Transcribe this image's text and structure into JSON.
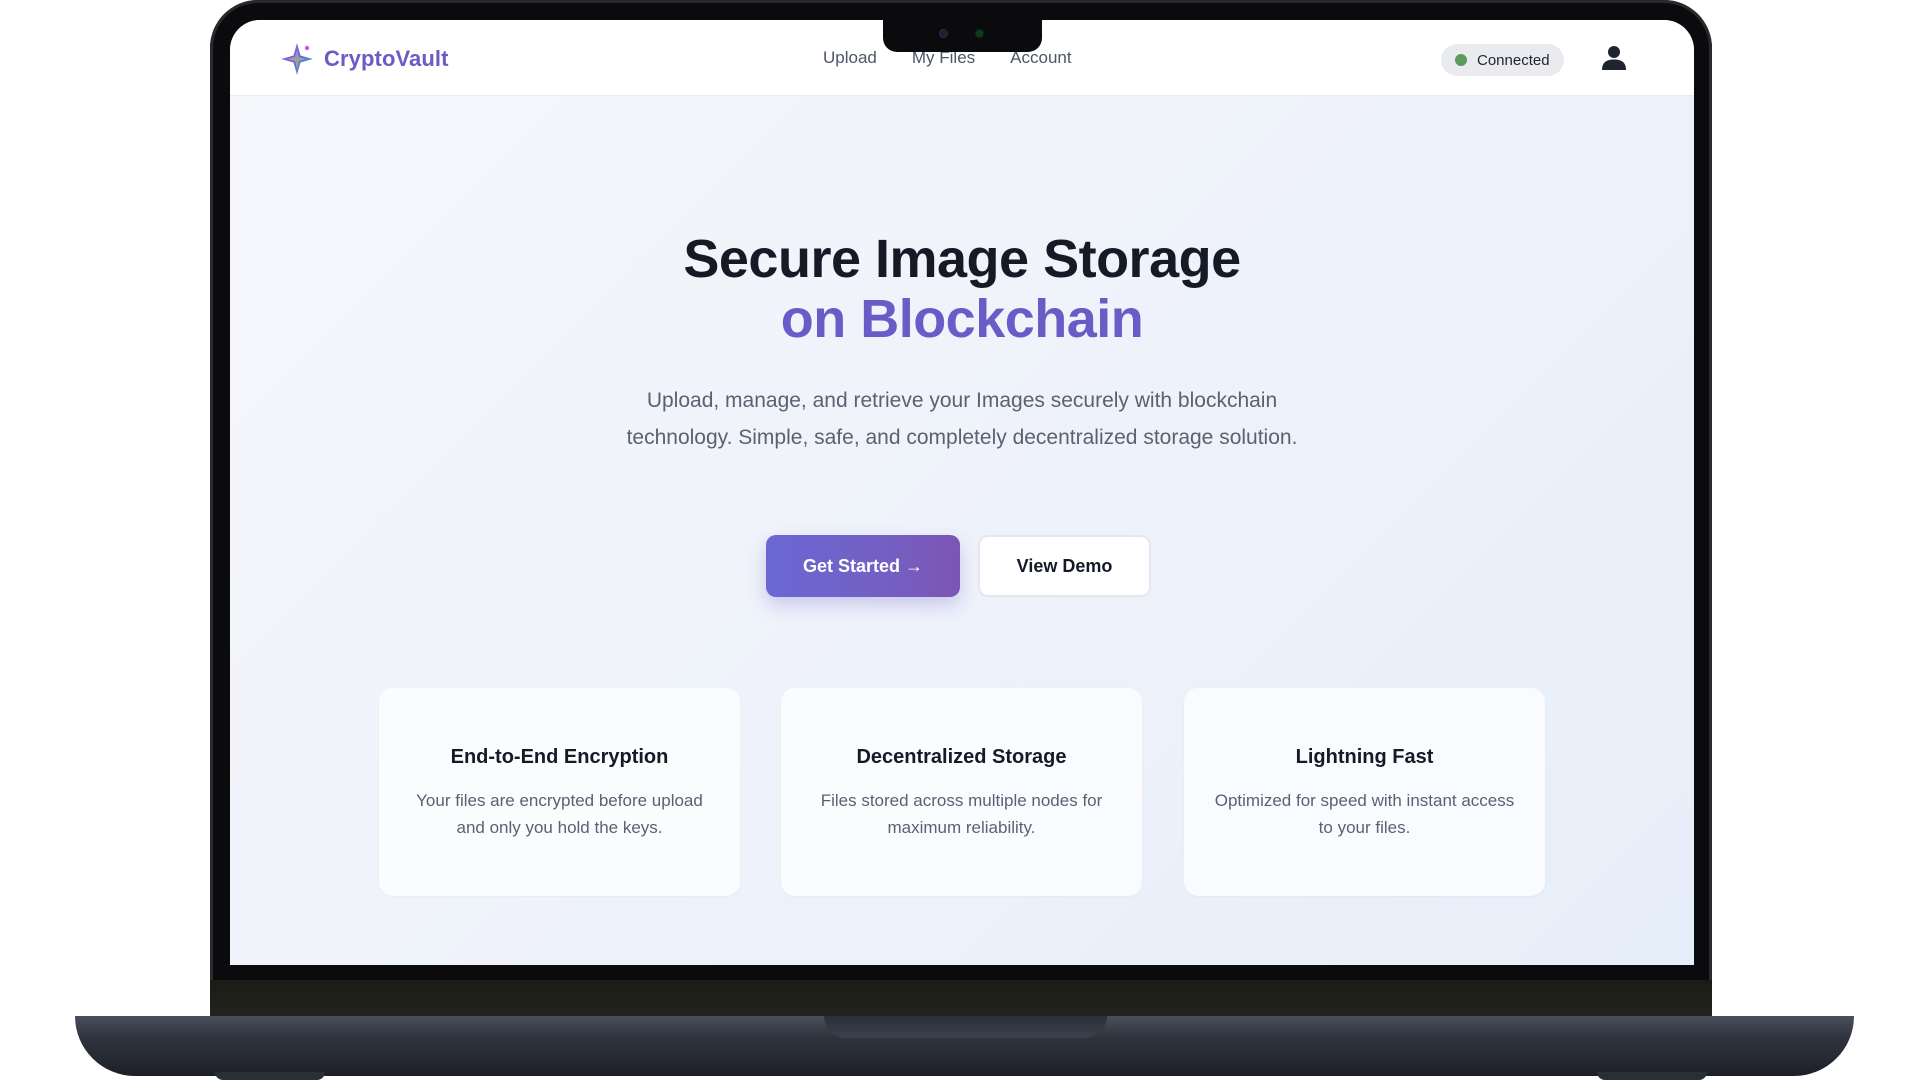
{
  "nav": {
    "brand": "CryptoVault",
    "links": [
      "Upload",
      "My Files",
      "Account"
    ],
    "status": "Connected"
  },
  "hero": {
    "title_line1": "Secure Image Storage",
    "title_line2": "on Blockchain",
    "subtitle": "Upload, manage, and retrieve your Images securely with blockchain technology. Simple, safe, and completely decentralized storage solution.",
    "primary_cta": "Get Started →",
    "secondary_cta": "View Demo"
  },
  "features": [
    {
      "title": "End-to-End Encryption",
      "desc": "Your files are encrypted before upload and only you hold the keys."
    },
    {
      "title": "Decentralized Storage",
      "desc": "Files stored across multiple nodes for maximum reliability."
    },
    {
      "title": "Lightning Fast",
      "desc": "Optimized for speed with instant access to your files."
    }
  ],
  "colors": {
    "accent": "#6a5bc7",
    "status_dot": "#5b9b5e",
    "heading": "#151a26",
    "body_text": "#5a6272"
  },
  "icons": [
    "sparkle-logo-icon",
    "user-icon"
  ]
}
